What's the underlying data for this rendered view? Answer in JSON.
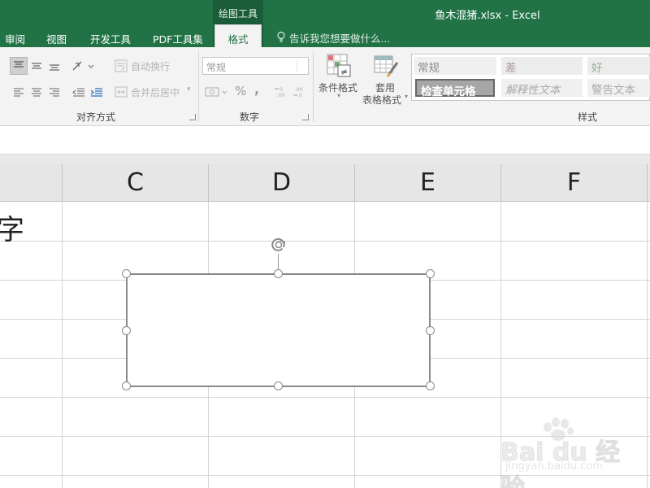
{
  "titlebar": {
    "contextual_group": "绘图工具",
    "document_title": "鱼木混猪.xlsx - Excel",
    "tabs": [
      {
        "label": "审阅"
      },
      {
        "label": "视图"
      },
      {
        "label": "开发工具"
      },
      {
        "label": "PDF工具集"
      }
    ],
    "active_tab": "格式",
    "tell_me_placeholder": "告诉我您想要做什么..."
  },
  "ribbon": {
    "alignment": {
      "wrap_text": "自动换行",
      "merge_center": "合并后居中",
      "group_label": "对齐方式"
    },
    "number": {
      "format_value": "常规",
      "percent": "%",
      "comma": ",",
      "group_label": "数字"
    },
    "styles": {
      "conditional_format": "条件格式",
      "table_format_line1": "套用",
      "table_format_line2": "表格格式",
      "cell_styles": [
        {
          "label": "常规"
        },
        {
          "label": "差"
        },
        {
          "label": "好"
        },
        {
          "label": "检查单元格"
        },
        {
          "label": "解释性文本"
        },
        {
          "label": "警告文本"
        }
      ],
      "group_label": "样式"
    }
  },
  "sheet": {
    "columns": [
      "C",
      "D",
      "E",
      "F"
    ],
    "cell_text": "字"
  },
  "watermark": {
    "logo": "Bai du 经验",
    "url": "jingyan.baidu.com"
  },
  "colors": {
    "excel_green": "#217346",
    "ribbon_bg": "#f3f3f3",
    "header_bg": "#e6e6e6"
  }
}
